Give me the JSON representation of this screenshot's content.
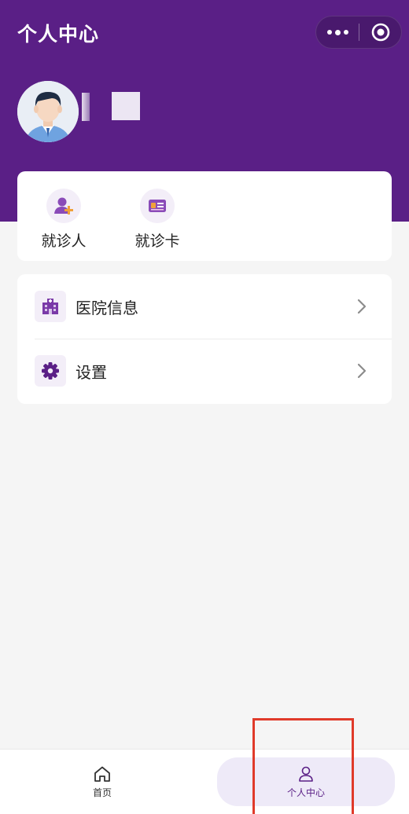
{
  "header": {
    "title": "个人中心",
    "bg_color": "#5a1f86"
  },
  "capsule": {
    "more_icon": "more-dots-icon",
    "close_icon": "target-close-icon"
  },
  "profile": {
    "avatar_icon": "user-avatar"
  },
  "quick_actions": [
    {
      "label": "就诊人",
      "icon": "add-person-icon"
    },
    {
      "label": "就诊卡",
      "icon": "id-card-icon"
    }
  ],
  "menu": [
    {
      "label": "医院信息",
      "icon": "hospital-icon"
    },
    {
      "label": "设置",
      "icon": "gear-icon"
    }
  ],
  "tabbar": {
    "items": [
      {
        "label": "首页",
        "icon": "home-icon"
      },
      {
        "label": "个人中心",
        "icon": "person-icon",
        "active": true
      }
    ],
    "active_color": "#5a1f86"
  },
  "highlight_color": "#e03a2a"
}
